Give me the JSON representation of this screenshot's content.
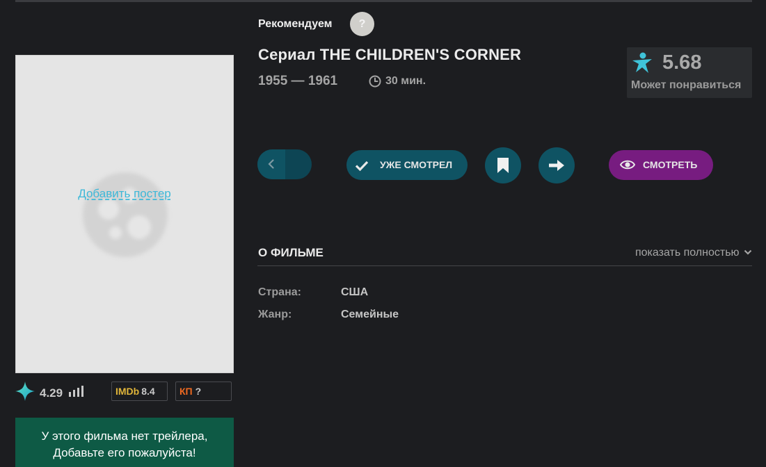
{
  "poster": {
    "add_label": "Добавить постер"
  },
  "ratings": {
    "site_rating": "4.29",
    "imdb_label": "IMDb",
    "imdb_value": "8.4",
    "kp_label": "КП",
    "kp_value": "?"
  },
  "trailer": {
    "line1": "У этого фильма нет трейлера,",
    "line2": "Добавьте его пожалуйста!"
  },
  "header": {
    "recommend_label": "Рекомендуем",
    "help_label": "?",
    "title": "Сериал THE CHILDREN'S CORNER",
    "years": "1955 — 1961",
    "duration": "30 мин."
  },
  "score": {
    "value": "5.68",
    "label": "Может понравиться"
  },
  "actions": {
    "watched_label": "УЖЕ СМОТРЕЛ",
    "watch_label": "СМОТРЕТЬ"
  },
  "about": {
    "heading": "О ФИЛЬМЕ",
    "show_full": "показать полностью",
    "rows": [
      {
        "label": "Страна:",
        "value": "США"
      },
      {
        "label": "Жанр:",
        "value": "Семейные"
      }
    ]
  },
  "colors": {
    "background": "#1c1d20",
    "teal_button": "#0f5363",
    "watch_button": "#771c80",
    "trailer_bg": "#0e5a45",
    "accent_link": "#3db8d8",
    "imdb": "#e0b53a",
    "kp": "#ef6a21"
  },
  "icons": [
    "star-icon",
    "signal-bars-icon",
    "help-icon",
    "clock-icon",
    "person-star-icon",
    "chevron-left-icon",
    "check-icon",
    "bookmark-icon",
    "arrow-right-icon",
    "eye-icon",
    "chevron-down-icon",
    "film-reel-icon"
  ]
}
